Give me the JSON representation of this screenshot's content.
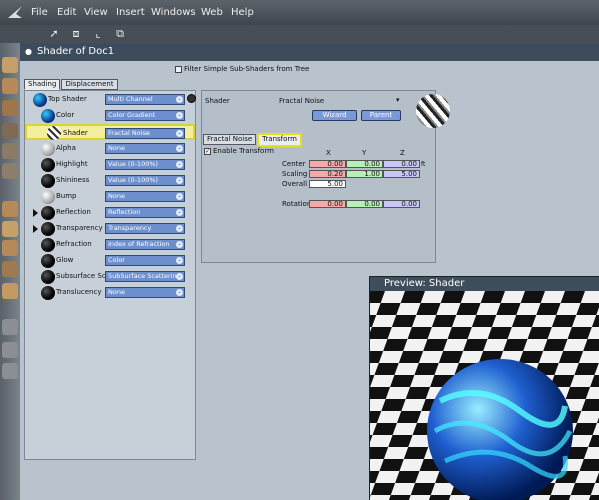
{
  "menu": [
    "File",
    "Edit",
    "View",
    "Insert",
    "Windows",
    "Web",
    "Help"
  ],
  "tools": [
    "select-arrow-icon",
    "frame-icon",
    "move-icon",
    "scale-icon"
  ],
  "window_title": "Shader of Doc1",
  "filter": {
    "label": "Filter Simple Sub-Shaders from Tree"
  },
  "left_tabs": [
    "Shading",
    "Displacement"
  ],
  "tree": [
    {
      "label": "Top Shader",
      "value": "Multi Channel",
      "ball": "blue"
    },
    {
      "label": "Color",
      "value": "Color Gradient",
      "ball": "blue"
    },
    {
      "label": "Shader",
      "value": "Fractal Noise",
      "ball": "stripe"
    },
    {
      "label": "Alpha",
      "value": "None",
      "ball": "white"
    },
    {
      "label": "Highlight",
      "value": "Value (0-100%)",
      "ball": "dark"
    },
    {
      "label": "Shininess",
      "value": "Value (0-100%)",
      "ball": "dark"
    },
    {
      "label": "Bump",
      "value": "None",
      "ball": "white"
    },
    {
      "label": "Reflection",
      "value": "Reflection",
      "ball": "dark"
    },
    {
      "label": "Transparency",
      "value": "Transparency",
      "ball": "dark"
    },
    {
      "label": "Refraction",
      "value": "Index of Refraction",
      "ball": "dark"
    },
    {
      "label": "Glow",
      "value": "Color",
      "ball": "dark"
    },
    {
      "label": "Subsurface Sc",
      "value": "SubSurface Scattering",
      "ball": "dark"
    },
    {
      "label": "Translucency",
      "value": "None",
      "ball": "dark"
    }
  ],
  "shader_panel": {
    "label": "Shader",
    "name": "Fractal Noise",
    "wizard": "Wizard",
    "parent": "Parent"
  },
  "right_tabs": [
    "Fractal Noise",
    "Transform"
  ],
  "transform": {
    "enable_label": "Enable Transform",
    "headers": [
      "X",
      "Y",
      "Z"
    ],
    "rows": [
      {
        "label": "Center",
        "values": [
          "0.00",
          "0.00",
          "0.00"
        ]
      },
      {
        "label": "Scaling",
        "values": [
          "0.20",
          "1.00",
          "5.00"
        ]
      },
      {
        "label": "Overall",
        "values": [
          "5.00"
        ]
      },
      {
        "label": "Rotation",
        "values": [
          "0.00",
          "0.00",
          "0.00"
        ]
      }
    ],
    "unit": "ft"
  },
  "preview": {
    "title": "Preview: Shader"
  }
}
